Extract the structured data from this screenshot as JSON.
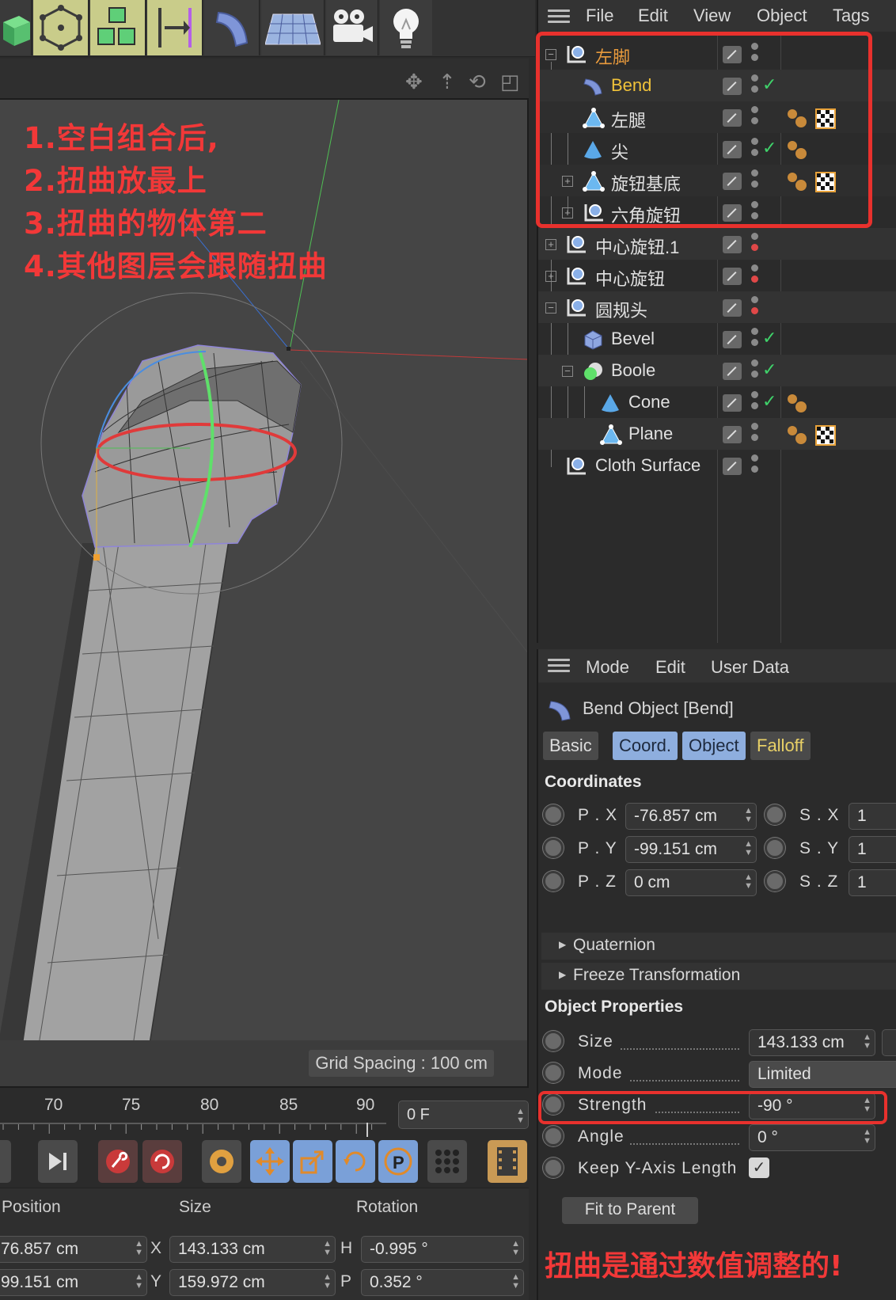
{
  "toolbar": {
    "buttons": [
      "cube-icon",
      "polygon-pen-icon",
      "cloner-icon",
      "symmetry-icon",
      "bend-deformer-icon",
      "floor-icon",
      "camera-icon",
      "light-icon"
    ]
  },
  "viewport": {
    "annotations": [
      "1.空白组合后,",
      "2.扭曲放最上",
      "3.扭曲的物体第二",
      "4.其他图层会跟随扭曲"
    ],
    "grid_spacing": "Grid Spacing : 100 cm"
  },
  "timeline": {
    "ticks": [
      "70",
      "75",
      "80",
      "85",
      "90"
    ],
    "current_frame": "0 F"
  },
  "coordinate_manager": {
    "headers": [
      "Position",
      "Size",
      "Rotation"
    ],
    "rows": [
      {
        "pos": "76.857 cm",
        "size_axis": "X",
        "size": "143.133 cm",
        "rot_axis": "H",
        "rot": "-0.995 °"
      },
      {
        "pos": "99.151 cm",
        "size_axis": "Y",
        "size": "159.972 cm",
        "rot_axis": "P",
        "rot": "0.352 °"
      }
    ]
  },
  "object_manager": {
    "menu": [
      "File",
      "Edit",
      "View",
      "Object",
      "Tags"
    ],
    "objects": [
      {
        "name": "左脚",
        "color": "#e89a3c"
      },
      {
        "name": "Bend",
        "color": "#f0c23a"
      },
      {
        "name": "左腿"
      },
      {
        "name": "尖"
      },
      {
        "name": "旋钮基底"
      },
      {
        "name": "六角旋钮"
      },
      {
        "name": "中心旋钮.1"
      },
      {
        "name": "中心旋钮"
      },
      {
        "name": "圆规头"
      },
      {
        "name": "Bevel"
      },
      {
        "name": "Boole"
      },
      {
        "name": "Cone"
      },
      {
        "name": "Plane"
      },
      {
        "name": "Cloth Surface"
      }
    ]
  },
  "attribute_manager": {
    "menu": [
      "Mode",
      "Edit",
      "User Data"
    ],
    "title": "Bend Object [Bend]",
    "tabs": [
      "Basic",
      "Coord.",
      "Object",
      "Falloff"
    ],
    "coordinates_heading": "Coordinates",
    "coords": [
      {
        "label": "P . X",
        "value": "-76.857 cm",
        "s_label": "S . X",
        "s_value": "1"
      },
      {
        "label": "P . Y",
        "value": "-99.151 cm",
        "s_label": "S . Y",
        "s_value": "1"
      },
      {
        "label": "P . Z",
        "value": "0 cm",
        "s_label": "S . Z",
        "s_value": "1"
      }
    ],
    "quaternion": "Quaternion",
    "freeze": "Freeze Transformation",
    "object_properties_heading": "Object Properties",
    "props": [
      {
        "label": "Size",
        "value": "143.133 cm"
      },
      {
        "label": "Mode",
        "value": "Limited"
      },
      {
        "label": "Strength",
        "value": "-90 °"
      },
      {
        "label": "Angle",
        "value": "0 °"
      }
    ],
    "keep_y_label": "Keep Y-Axis Length",
    "fit_to_parent": "Fit to Parent",
    "bottom_note": "扭曲是通过数值调整的!"
  },
  "colors": {
    "accent_red": "#e8312d",
    "selected_orange": "#e89a3c",
    "tab_blue": "#8eaede"
  }
}
